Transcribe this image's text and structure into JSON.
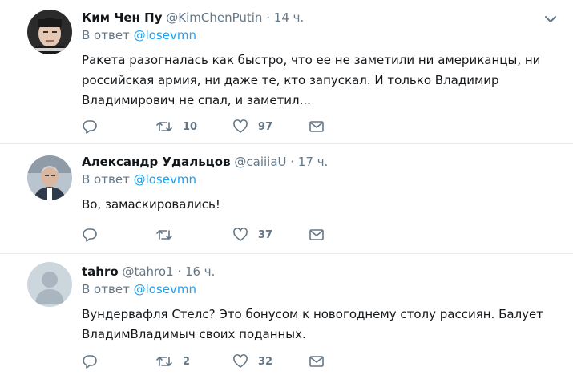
{
  "tweets": [
    {
      "name": "Ким Чен Пу",
      "handle": "@KimChenPutin",
      "dot": "·",
      "time": "14 ч.",
      "reply_prefix": "В ответ",
      "reply_to": "@losevmn",
      "text_lines": [
        "Ракета разогналась  как быстро, что ее не заметили ни американцы, ни",
        "российская армия, ни даже те, кто запускал. И только Владимир",
        "Владимирович не спал, и заметил..."
      ],
      "retweets": "10",
      "likes": "97"
    },
    {
      "name": "Александр Удальцов",
      "handle": "@caiiiaU",
      "dot": "·",
      "time": "17 ч.",
      "reply_prefix": "В ответ",
      "reply_to": "@losevmn",
      "text_lines": [
        "Во, замаскировались!"
      ],
      "retweets": "",
      "likes": "37"
    },
    {
      "name": "tahro",
      "handle": "@tahro1",
      "dot": "·",
      "time": "16 ч.",
      "reply_prefix": "В ответ",
      "reply_to": "@losevmn",
      "text_lines": [
        "Вундервафля Стелс? Это бонусом к новогоднему столу рассиян. Балует",
        "ВладимВладимыч своих поданных."
      ],
      "retweets": "2",
      "likes": "32"
    }
  ],
  "colors": {
    "muted": "#657786",
    "link": "#1da1f2",
    "text": "#14171a",
    "divider": "#e6ecf0"
  },
  "icons": [
    "reply-icon",
    "retweet-icon",
    "like-icon",
    "direct-message-icon",
    "chevron-down-icon"
  ]
}
